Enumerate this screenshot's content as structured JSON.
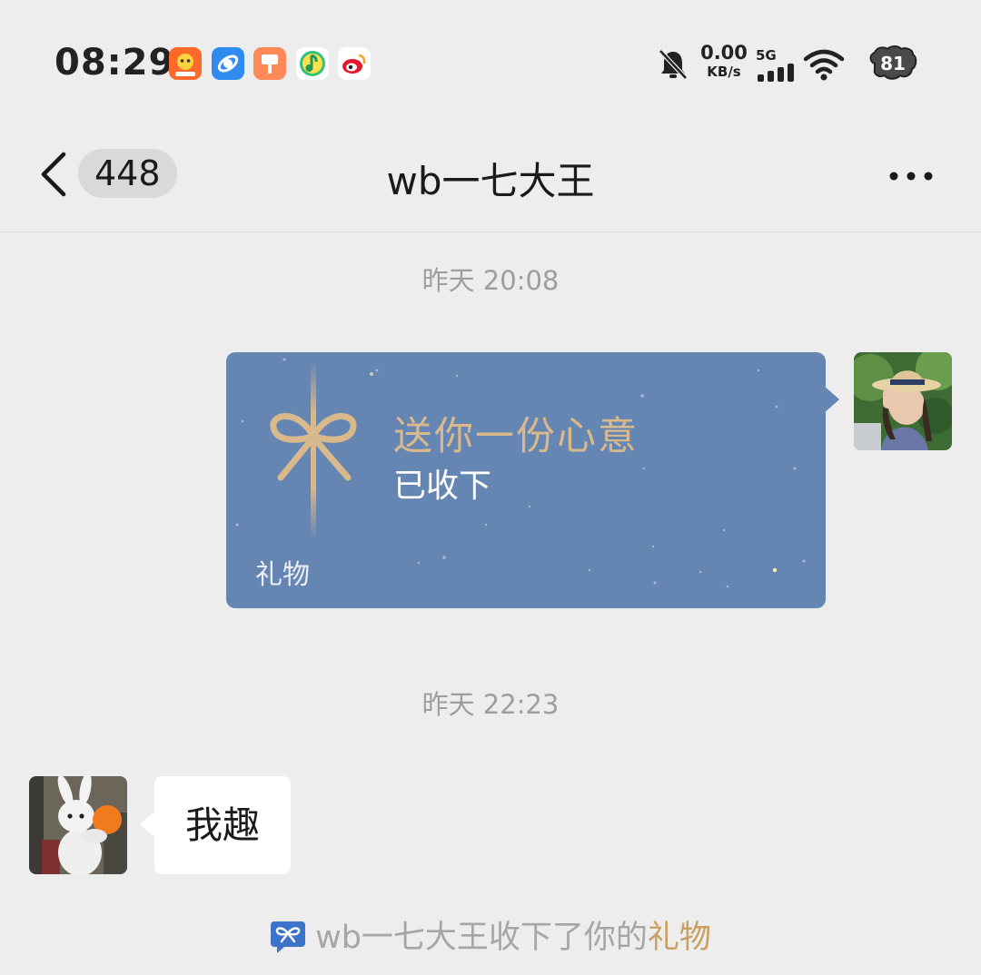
{
  "status_bar": {
    "time": "08:29",
    "apps": [
      "taobao-icon",
      "browser-icon",
      "paint-icon",
      "qqmusic-icon",
      "weibo-icon"
    ],
    "mute_icon": "bell-mute-icon",
    "net_speed_value": "0.00",
    "net_speed_unit": "KB/s",
    "network_type": "5G",
    "battery_level": "81"
  },
  "nav": {
    "unread_count": "448",
    "title": "wb一七大王",
    "more_icon": "more-dots-icon"
  },
  "messages": [
    {
      "type": "timestamp",
      "text": "昨天 20:08"
    },
    {
      "type": "gift",
      "sender": "me",
      "title": "送你一份心意",
      "status": "已收下",
      "label": "礼物",
      "colors": {
        "card": "#6586b2",
        "title": "#d9b98c"
      }
    },
    {
      "type": "timestamp",
      "text": "昨天 22:23"
    },
    {
      "type": "text",
      "sender": "other",
      "text": "我趣"
    }
  ],
  "system_notice": {
    "prefix": "wb一七大王收下了你的",
    "link": "礼物",
    "link_color": "#c9a062"
  }
}
